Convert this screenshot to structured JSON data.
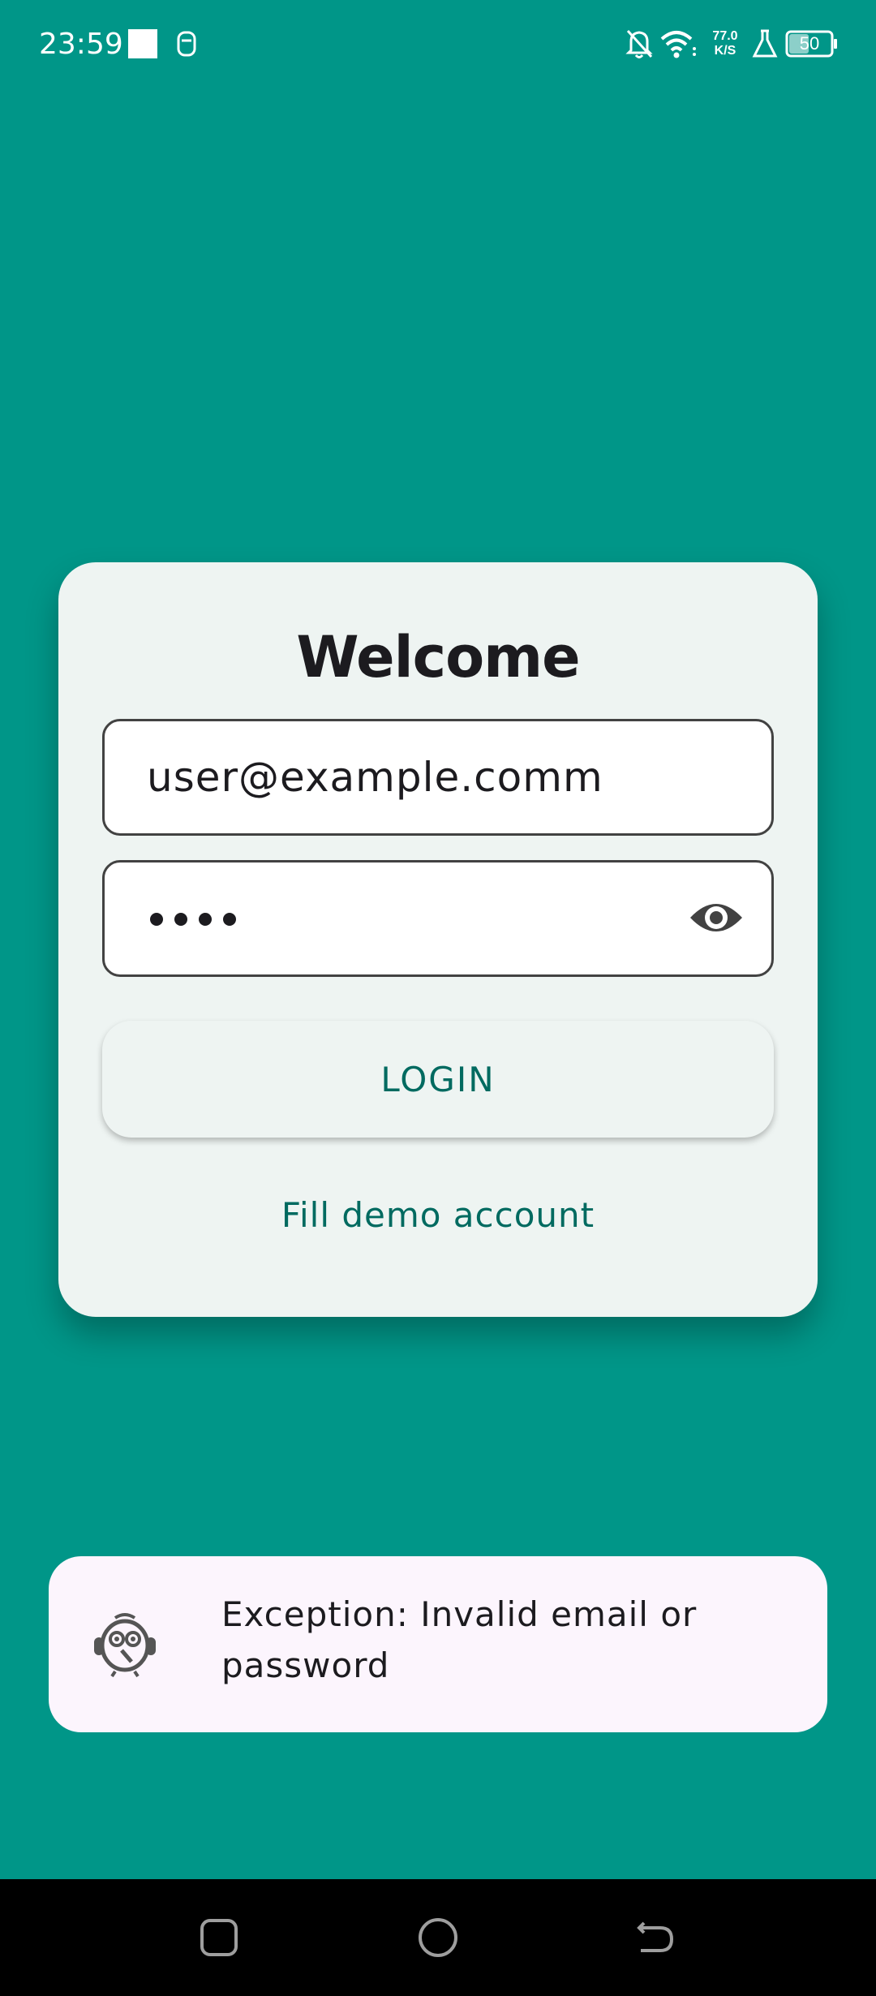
{
  "status_bar": {
    "time": "23:59",
    "network_speed_value": "77.0",
    "network_speed_unit": "K/S",
    "battery": "50"
  },
  "login": {
    "title": "Welcome",
    "email_value": "user@example.comm",
    "password_masked_length": 4,
    "login_button": "LOGIN",
    "demo_link": "Fill demo account"
  },
  "snackbar": {
    "message": "Exception: Invalid email or password"
  },
  "colors": {
    "background": "#009688",
    "card": "#eef4f2",
    "accent_text": "#006a60",
    "snackbar": "#fcf5fd"
  }
}
